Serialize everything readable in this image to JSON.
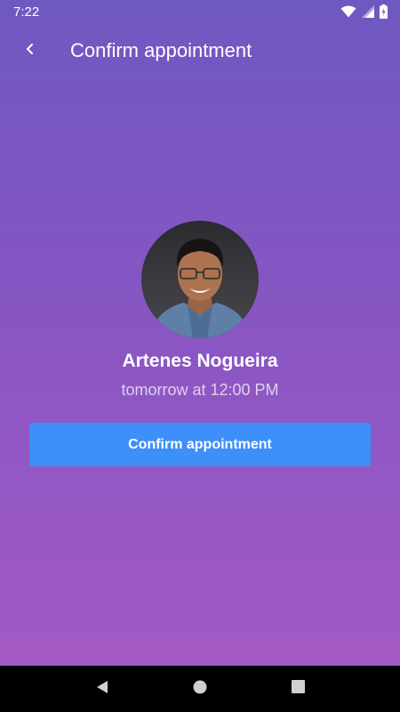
{
  "status_bar": {
    "time": "7:22",
    "icons": [
      "wifi-icon",
      "signal-icon",
      "battery-charging-icon"
    ]
  },
  "header": {
    "title": "Confirm appointment",
    "back_icon": "chevron-left-icon"
  },
  "profile": {
    "name": "Artenes Nogueira",
    "appointment_time": "tomorrow at 12:00 PM",
    "avatar": "doctor-avatar"
  },
  "actions": {
    "confirm_label": "Confirm appointment"
  },
  "nav_bar": {
    "icons": [
      "back-triangle-icon",
      "home-circle-icon",
      "recents-square-icon"
    ]
  },
  "colors": {
    "gradient_top": "#6f58c1",
    "gradient_bottom": "#a75ac5",
    "button": "#3d90f7"
  }
}
